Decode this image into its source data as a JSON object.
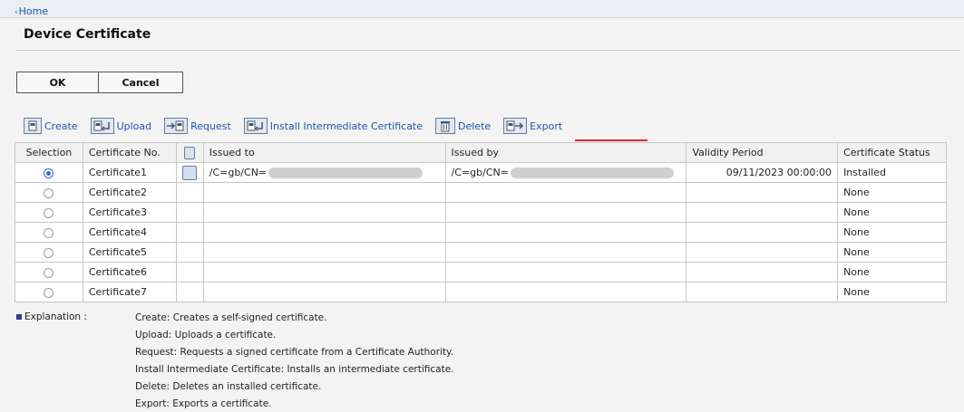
{
  "nav": {
    "home_label": "Home"
  },
  "page": {
    "title": "Device Certificate"
  },
  "buttons": {
    "ok_label": "OK",
    "cancel_label": "Cancel"
  },
  "toolbar": {
    "create": "Create",
    "upload": "Upload",
    "request": "Request",
    "install_intermediate": "Install Intermediate Certificate",
    "delete": "Delete",
    "export": "Export"
  },
  "table": {
    "headers": {
      "selection": "Selection",
      "certificate_no": "Certificate No.",
      "issued_to": "Issued to",
      "issued_by": "Issued by",
      "validity": "Validity Period",
      "status": "Certificate Status"
    },
    "rows": [
      {
        "name": "Certificate1",
        "selected": true,
        "issued_to": "/C=gb/CN=",
        "issued_by": "/C=gb/CN=",
        "validity": "09/11/2023 00:00:00",
        "status": "Installed"
      },
      {
        "name": "Certificate2",
        "selected": false,
        "issued_to": "",
        "issued_by": "",
        "validity": "",
        "status": "None"
      },
      {
        "name": "Certificate3",
        "selected": false,
        "issued_to": "",
        "issued_by": "",
        "validity": "",
        "status": "None"
      },
      {
        "name": "Certificate4",
        "selected": false,
        "issued_to": "",
        "issued_by": "",
        "validity": "",
        "status": "None"
      },
      {
        "name": "Certificate5",
        "selected": false,
        "issued_to": "",
        "issued_by": "",
        "validity": "",
        "status": "None"
      },
      {
        "name": "Certificate6",
        "selected": false,
        "issued_to": "",
        "issued_by": "",
        "validity": "",
        "status": "None"
      },
      {
        "name": "Certificate7",
        "selected": false,
        "issued_to": "",
        "issued_by": "",
        "validity": "",
        "status": "None"
      }
    ]
  },
  "explanation": {
    "label": "Explanation :",
    "lines": [
      "Create: Creates a self-signed certificate.",
      "Upload: Uploads a certificate.",
      "Request: Requests a signed certificate from a Certificate Authority.",
      "Install Intermediate Certificate: Installs an intermediate certificate.",
      "Delete: Deletes an installed certificate.",
      "Export: Exports a certificate."
    ]
  },
  "colors": {
    "link": "#1a56b0",
    "highlight_underline": "#e12a2a",
    "radio_selected": "#2b6ed6"
  }
}
